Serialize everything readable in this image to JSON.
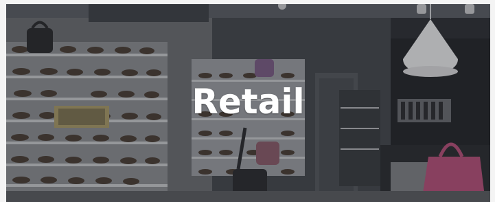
{
  "hero": {
    "title": "Retail"
  }
}
